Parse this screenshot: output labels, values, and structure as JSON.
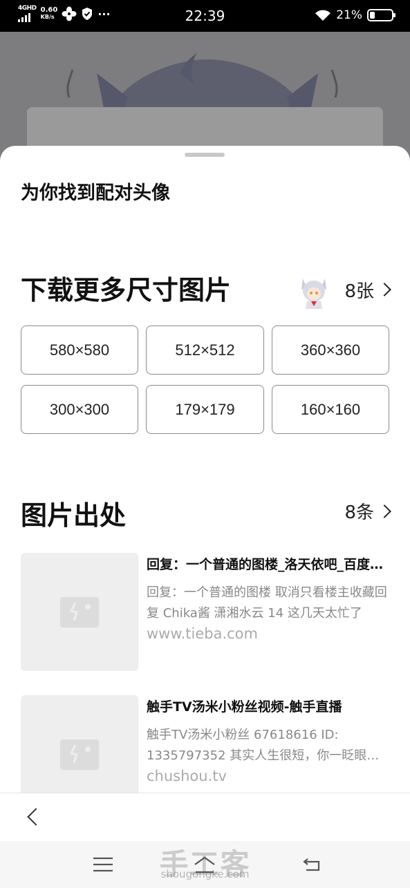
{
  "status_bar": {
    "network": "4GHD",
    "speed_value": "0.60",
    "speed_unit": "KB/s",
    "time": "22:39",
    "battery": "21%",
    "more": "···"
  },
  "sheet": {
    "matched_title": "为你找到配对头像",
    "download_section": {
      "title": "下载更多尺寸图片",
      "count": "8张",
      "sizes": [
        "580×580",
        "512×512",
        "360×360",
        "300×300",
        "179×179",
        "160×160"
      ]
    },
    "source_section": {
      "title": "图片出处",
      "count": "8条",
      "results": [
        {
          "title": "回复：一个普通的图楼_洛天依吧_百度贴吧",
          "desc": "回复：一个普通的图楼 取消只看楼主收藏回复 Chika酱 潇湘水云 14 这几天太忙了",
          "source": "www.tieba.com"
        },
        {
          "title": "触手TV汤米小粉丝视频-触手直播",
          "desc": "触手TV汤米小粉丝 67618616 ID: 1335797352 其实人生很短，你一眨眼就过去了",
          "source": "chushou.tv"
        }
      ]
    }
  },
  "watermark": {
    "text": "手工客",
    "url": "shougongke.com"
  }
}
